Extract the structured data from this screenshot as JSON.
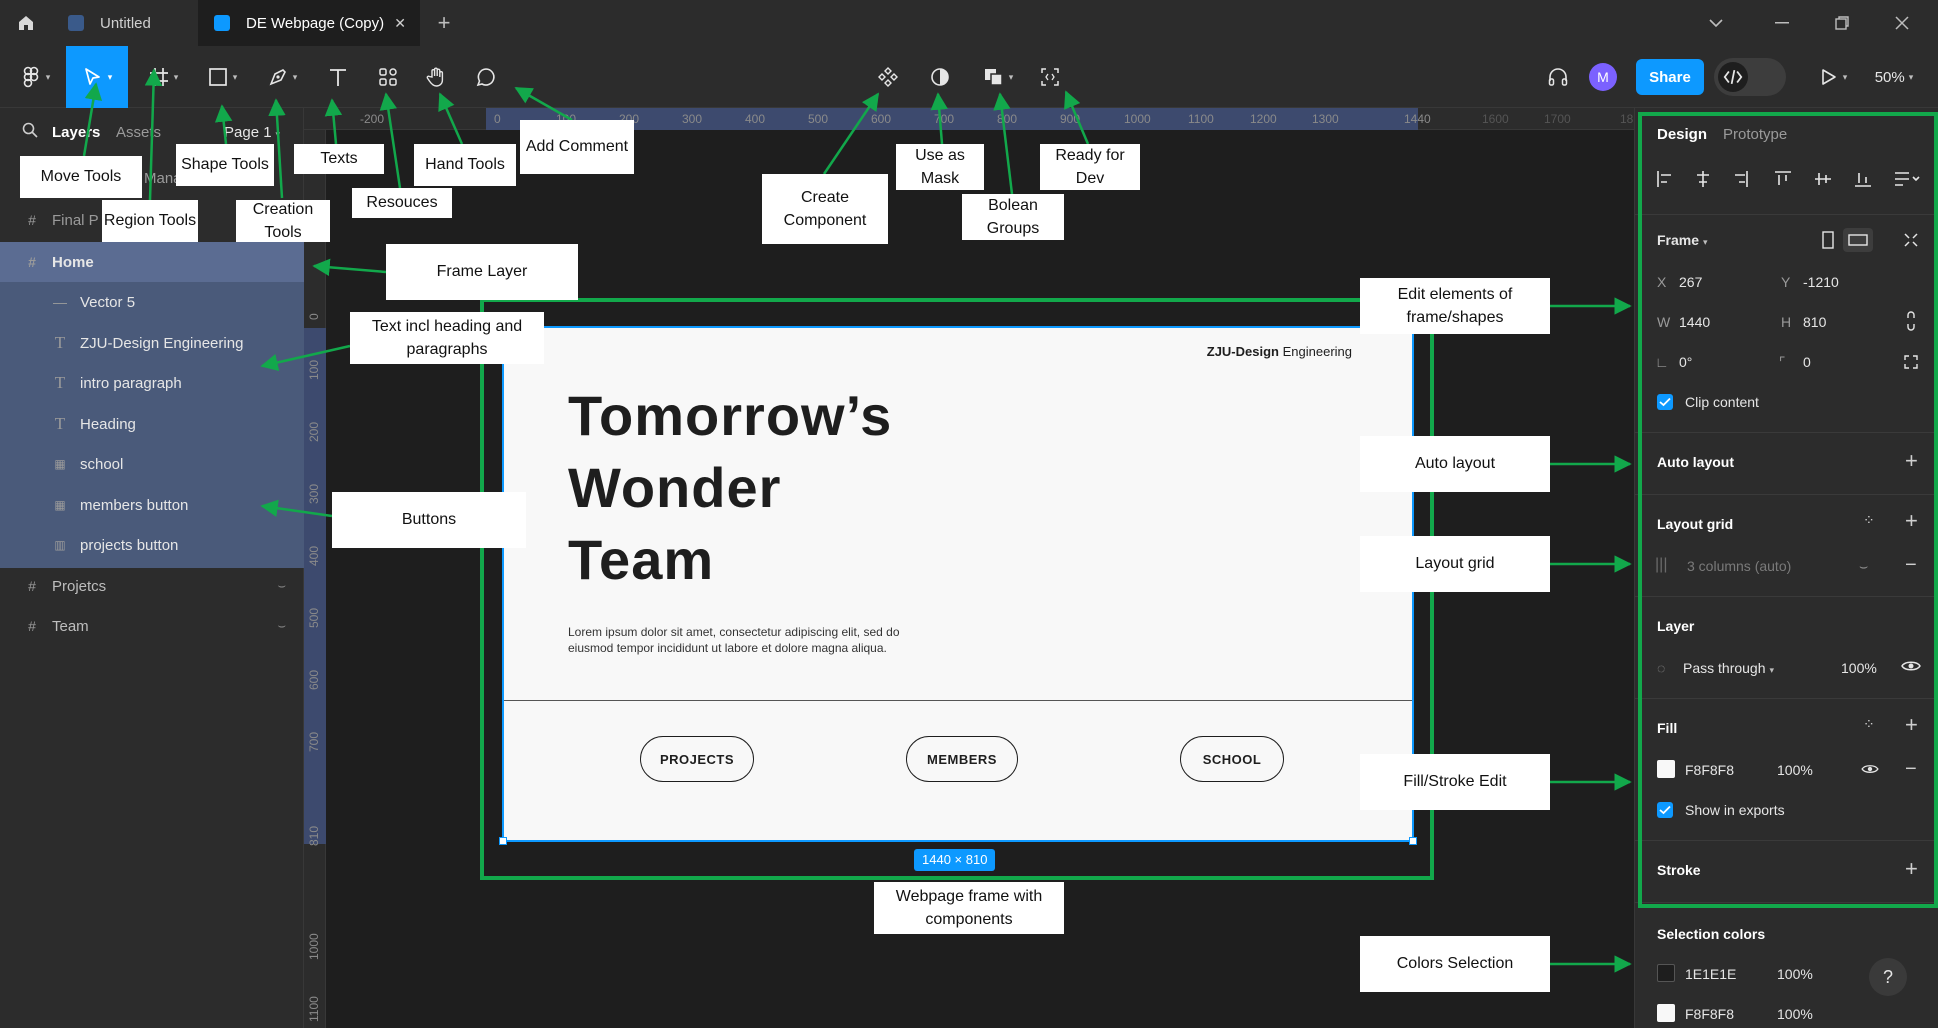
{
  "titlebar": {
    "tabs": [
      {
        "label": "Untitled",
        "active": false
      },
      {
        "label": "DE Webpage (Copy)",
        "active": true
      }
    ],
    "new_tab": "+",
    "close": "✕"
  },
  "toolbar": {
    "zoom": "50%",
    "share_label": "Share",
    "avatar_initial": "M",
    "accent": "#0d99ff"
  },
  "left_panel": {
    "tabs": [
      "Layers",
      "Assets"
    ],
    "page": "Page 1",
    "hidden_row_text": "Final P",
    "hidden_row_text2": "Manageme",
    "layers": [
      {
        "name": "Home",
        "icon": "frame-icon",
        "selected": true
      },
      {
        "name": "Vector 5",
        "icon": "vector-icon"
      },
      {
        "name": "ZJU-Design Engineering",
        "icon": "text-icon"
      },
      {
        "name": "intro paragraph",
        "icon": "text-icon"
      },
      {
        "name": "Heading",
        "icon": "text-icon"
      },
      {
        "name": "school",
        "icon": "component-icon"
      },
      {
        "name": "members button",
        "icon": "component-icon"
      },
      {
        "name": "projects button",
        "icon": "grid-icon"
      },
      {
        "name": "Projetcs",
        "icon": "frame-icon"
      },
      {
        "name": "Team",
        "icon": "frame-icon"
      }
    ]
  },
  "ruler": {
    "h_ticks": [
      "-200",
      "0",
      "100",
      "200",
      "300",
      "400",
      "500",
      "600",
      "700",
      "800",
      "900",
      "1000",
      "1100",
      "1200",
      "1300",
      "1440",
      "1600",
      "1700",
      "18"
    ],
    "v_ticks": [
      "0",
      "100",
      "200",
      "300",
      "400",
      "500",
      "600",
      "700",
      "810",
      "1000",
      "1100"
    ]
  },
  "frame": {
    "brand_bold": "ZJU-Design",
    "brand_light": "Engineering",
    "heading_lines": [
      "Tomorrow’s",
      "Wonder",
      "Team"
    ],
    "intro": "Lorem ipsum dolor sit amet, consectetur adipiscing elit, sed do eiusmod tempor incididunt ut labore et dolore magna aliqua.",
    "buttons": [
      "PROJECTS",
      "MEMBERS",
      "SCHOOL"
    ],
    "size_badge": "1440 × 810",
    "fill": "#f8f8f8"
  },
  "right_panel": {
    "tabs": [
      "Design",
      "Prototype"
    ],
    "frame_label": "Frame",
    "x_label": "X",
    "x": "267",
    "y_label": "Y",
    "y": "-1210",
    "w_label": "W",
    "w": "1440",
    "h_label": "H",
    "h": "810",
    "rotation": "0°",
    "radius": "0",
    "clip_content": "Clip content",
    "auto_layout": "Auto layout",
    "layout_grid": "Layout grid",
    "grid_value": "3 columns (auto)",
    "layer": "Layer",
    "blend": "Pass through",
    "opacity": "100%",
    "fill": "Fill",
    "fill_hex": "F8F8F8",
    "fill_opacity": "100%",
    "show_in_exports": "Show in exports",
    "stroke": "Stroke",
    "selection_colors": "Selection colors",
    "sel_colors": [
      {
        "hex": "1E1E1E",
        "opacity": "100%",
        "swatch": "#1e1e1e"
      },
      {
        "hex": "F8F8F8",
        "opacity": "100%",
        "swatch": "#f8f8f8"
      }
    ],
    "help": "?"
  },
  "annotations": {
    "move_tools": "Move Tools",
    "region_tools": "Region Tools",
    "shape_tools": "Shape Tools",
    "creation_tools": "Creation Tools",
    "texts": "Texts",
    "resources": "Resouces",
    "hand_tools": "Hand Tools",
    "add_comment": "Add Comment",
    "create_component": "Create Component",
    "use_as_mask": "Use as Mask",
    "boolean_groups": "Bolean Groups",
    "ready_for_dev": "Ready for Dev",
    "frame_layer": "Frame Layer",
    "text_incl": "Text incl heading and paragraphs",
    "buttons": "Buttons",
    "edit_elements": "Edit elements of frame/shapes",
    "auto_layout": "Auto layout",
    "layout_grid": "Layout grid",
    "fill_stroke": "Fill/Stroke Edit",
    "colors_selection": "Colors Selection",
    "webpage_frame": "Webpage frame with components",
    "annotation_color": "#12a84b"
  }
}
